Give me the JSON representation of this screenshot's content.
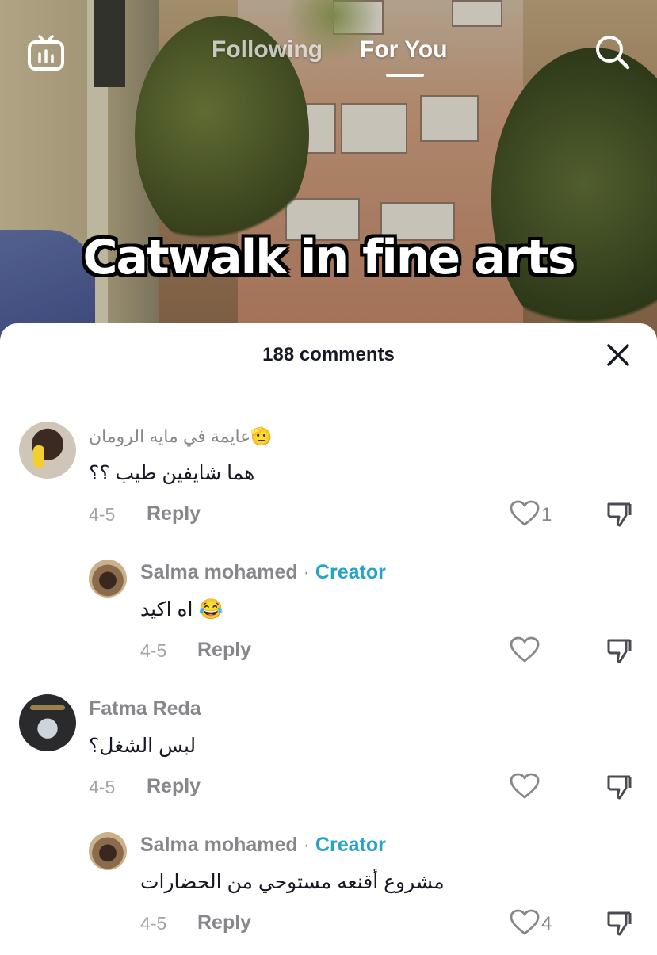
{
  "top_bar": {
    "tabs": [
      "Following",
      "For You"
    ],
    "active_tab": "For You"
  },
  "video": {
    "caption": "Catwalk in fine arts"
  },
  "comments_sheet": {
    "title": "188 comments",
    "comments": [
      {
        "username": "عايمة في مايه الرومان🫡",
        "text": "هما شايفين طيب ؟؟",
        "date": "4-5",
        "reply_label": "Reply",
        "likes": "1",
        "is_reply": false
      },
      {
        "username": "Salma mohamed",
        "badge": "Creator",
        "separator": "·",
        "text": "😂 اه اكيد",
        "date": "4-5",
        "reply_label": "Reply",
        "likes": "",
        "is_reply": true
      },
      {
        "username": "Fatma Reda",
        "text": "لبس الشغل؟",
        "date": "4-5",
        "reply_label": "Reply",
        "likes": "",
        "is_reply": false
      },
      {
        "username": "Salma mohamed",
        "badge": "Creator",
        "separator": "·",
        "text": "مشروع أقنعه مستوحي من الحضارات",
        "date": "4-5",
        "reply_label": "Reply",
        "likes": "4",
        "is_reply": true
      }
    ]
  },
  "colors": {
    "creator_badge": "#25a4c6",
    "meta_gray": "#86878b",
    "text_dark": "#161823"
  },
  "icons": [
    "tv-icon",
    "search-icon",
    "close-icon",
    "heart-icon",
    "dislike-icon"
  ]
}
